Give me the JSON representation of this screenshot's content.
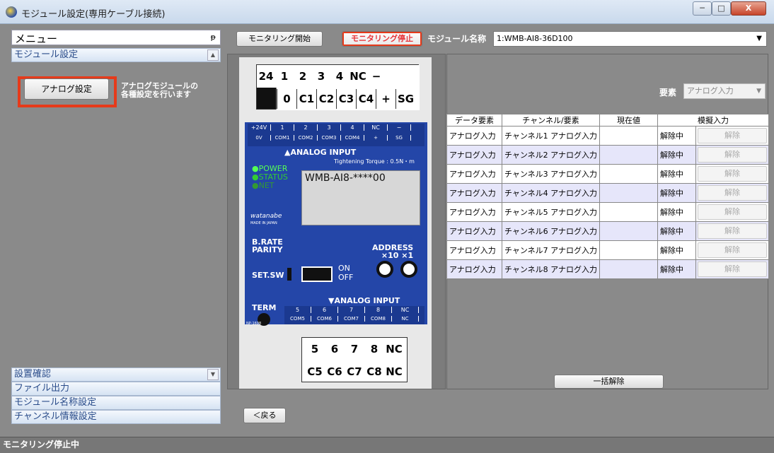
{
  "window": {
    "title": "モジュール設定(専用ケーブル接続)",
    "min_icon": "minimize-icon",
    "max_icon": "maximize-icon",
    "close_icon": "close-icon",
    "min_glyph": "─",
    "max_glyph": "□",
    "close_glyph": "X"
  },
  "sidebar": {
    "menu_title": "メニュー",
    "pin_glyph": "ᵽ",
    "sections": [
      {
        "label": "モジュール設定"
      },
      {
        "label": "設置確認"
      },
      {
        "label": "ファイル出力"
      },
      {
        "label": "モジュール名称設定"
      },
      {
        "label": "チャンネル情報設定"
      }
    ],
    "analog_button": "アナログ設定",
    "analog_desc": "アナログモジュールの各種設定を行います",
    "scroll_up": "▲",
    "scroll_down": "▼"
  },
  "toolbar": {
    "start_label": "モニタリング開始",
    "stop_label": "モニタリング停止",
    "module_name_label": "モジュール名称",
    "module_name_value": "1:WMB-AI8-36D100",
    "select_arrow": "▼"
  },
  "device": {
    "top_terminal_row1": [
      "24",
      "1",
      "2",
      "3",
      "4",
      "NC",
      "−"
    ],
    "top_terminal_row2": [
      "0",
      "C1",
      "C2",
      "C3",
      "C4",
      "+",
      "SG"
    ],
    "bottom_terminal_row1": [
      "5",
      "6",
      "7",
      "8",
      "NC"
    ],
    "bottom_terminal_row2": [
      "C5",
      "C6",
      "C7",
      "C8",
      "NC"
    ],
    "strip_top": [
      "+24V",
      "1",
      "2",
      "3",
      "4",
      "NC",
      "−"
    ],
    "strip_top_2": [
      "0V",
      "COM1",
      "COM2",
      "COM3",
      "COM4",
      "+",
      "SG"
    ],
    "analog_input_top": "▲ANALOG INPUT",
    "torque": "Tightening Torque : 0.5N・m",
    "leds": [
      "●POWER",
      "●STATUS",
      "●NET"
    ],
    "lcd_text": "WMB-AI8-****00",
    "brand": "watanabe",
    "made_in": "MADE IN JAPAN",
    "b_rate": "B.RATE",
    "parity": "PARITY",
    "address": "ADDRESS",
    "address_mult": "×10  ×1",
    "set_sw": "SET.SW",
    "on": "ON",
    "off": "OFF",
    "analog_input_bottom": "▼ANALOG INPUT",
    "term": "TERM",
    "np_code": "NP-1698",
    "strip_bottom": [
      "5",
      "6",
      "7",
      "8",
      "NC"
    ],
    "strip_bottom_2": [
      "COM5",
      "COM6",
      "COM7",
      "COM8",
      "NC"
    ]
  },
  "element": {
    "label": "要素",
    "value": "アナログ入力",
    "arrow": "▼"
  },
  "table": {
    "headers": [
      "データ要素",
      "チャンネル/要素",
      "現在値",
      "模擬入力"
    ],
    "rows": [
      {
        "data": "アナログ入力",
        "channel": "チャンネル1 アナログ入力",
        "value": "",
        "state": "解除中",
        "btn": "解除"
      },
      {
        "data": "アナログ入力",
        "channel": "チャンネル2 アナログ入力",
        "value": "",
        "state": "解除中",
        "btn": "解除"
      },
      {
        "data": "アナログ入力",
        "channel": "チャンネル3 アナログ入力",
        "value": "",
        "state": "解除中",
        "btn": "解除"
      },
      {
        "data": "アナログ入力",
        "channel": "チャンネル4 アナログ入力",
        "value": "",
        "state": "解除中",
        "btn": "解除"
      },
      {
        "data": "アナログ入力",
        "channel": "チャンネル5 アナログ入力",
        "value": "",
        "state": "解除中",
        "btn": "解除"
      },
      {
        "data": "アナログ入力",
        "channel": "チャンネル6 アナログ入力",
        "value": "",
        "state": "解除中",
        "btn": "解除"
      },
      {
        "data": "アナログ入力",
        "channel": "チャンネル7 アナログ入力",
        "value": "",
        "state": "解除中",
        "btn": "解除"
      },
      {
        "data": "アナログ入力",
        "channel": "チャンネル8 アナログ入力",
        "value": "",
        "state": "解除中",
        "btn": "解除"
      }
    ],
    "batch_clear": "一括解除"
  },
  "nav": {
    "back": "＜戻る"
  },
  "status": {
    "text": "モニタリング停止中"
  }
}
